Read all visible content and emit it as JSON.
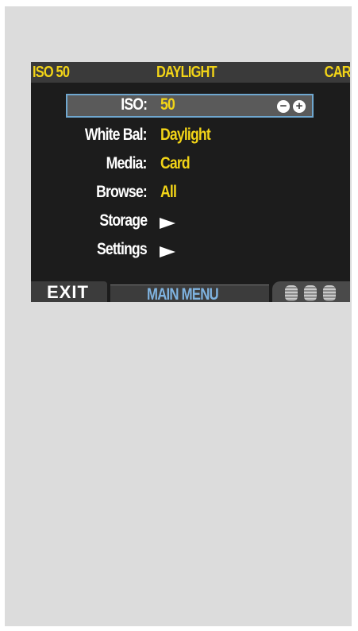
{
  "status_bar": {
    "iso": "ISO 50",
    "white_balance": "DAYLIGHT",
    "media": "CARD"
  },
  "menu": {
    "items": [
      {
        "label": "ISO:",
        "value": "50",
        "selected": true,
        "has_stepper": true
      },
      {
        "label": "White Bal:",
        "value": "Daylight"
      },
      {
        "label": "Media:",
        "value": "Card"
      },
      {
        "label": "Browse:",
        "value": "All"
      },
      {
        "label": "Storage",
        "submenu": true
      },
      {
        "label": "Settings",
        "submenu": true
      }
    ],
    "stepper_icons": [
      "minus-circle-icon",
      "plus-circle-icon"
    ]
  },
  "footer": {
    "exit_label": "EXIT",
    "title": "MAIN MENU",
    "dial_icons": [
      "dial-icon",
      "dial-icon",
      "dial-icon"
    ]
  },
  "colors": {
    "accent_yellow": "#f2d417",
    "selection_border": "#6fa7cf",
    "title_blue": "#7fb3e0",
    "screen_bg": "#1c1c1c"
  }
}
